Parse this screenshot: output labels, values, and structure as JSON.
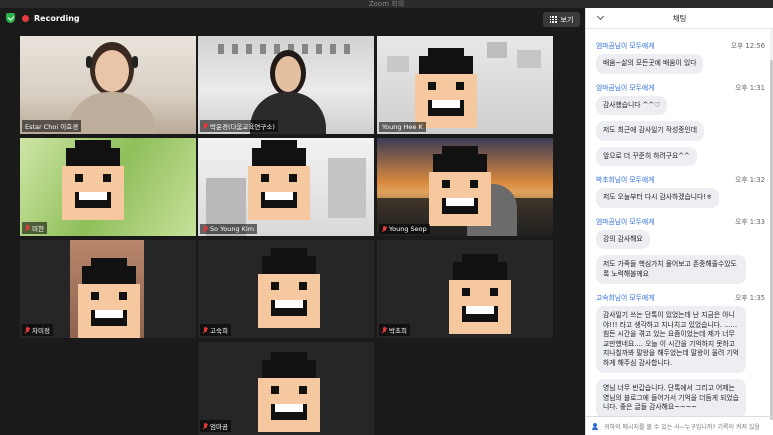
{
  "window": {
    "title": "Zoom 회의"
  },
  "recording": {
    "label": "Recording"
  },
  "view_button": {
    "label": "보기",
    "icon": "grid-icon"
  },
  "participants": [
    {
      "name": "Estar Choi 이효경",
      "muted": false,
      "active": true,
      "type": "photo"
    },
    {
      "name": "박윤경(다움교육연구소)",
      "muted": true,
      "active": false,
      "type": "photo"
    },
    {
      "name": "Young Hee K",
      "muted": false,
      "active": false,
      "type": "avatar"
    },
    {
      "name": "미현",
      "muted": true,
      "active": false,
      "type": "avatar"
    },
    {
      "name": "So Young Kim",
      "muted": true,
      "active": false,
      "type": "avatar"
    },
    {
      "name": "Young Seop",
      "muted": true,
      "active": false,
      "type": "avatar"
    },
    {
      "name": "차미정",
      "muted": true,
      "active": false,
      "type": "avatar"
    },
    {
      "name": "고숙희",
      "muted": true,
      "active": false,
      "type": "avatar"
    },
    {
      "name": "박초희",
      "muted": true,
      "active": false,
      "type": "avatar"
    },
    {
      "name": "엄마곰",
      "muted": true,
      "active": false,
      "type": "avatar"
    }
  ],
  "chat": {
    "title": "채팅",
    "messages": [
      {
        "from": "엄마곰님이 모두에게",
        "time": "오후 12:56",
        "text": "배움~삶의 모든곳에 배움이 있다"
      },
      {
        "from": "엄마곰님이 모두에게",
        "time": "오후 1:31",
        "text": "감사했습니다 ^^♡"
      },
      {
        "from": "",
        "time": "",
        "text": "저도 최근에 감사일기 작성중인데"
      },
      {
        "from": "",
        "time": "",
        "text": "앞으로 더 꾸준히 하려구요^^"
      },
      {
        "from": "박초희님이 모두에게",
        "time": "오후 1:32",
        "text": "저도 오늘부터 다시 감사하겠습니다!ㅎ"
      },
      {
        "from": "엄마곰님이 모두에게",
        "time": "오후 1:33",
        "text": "강의 감사해요"
      },
      {
        "from": "",
        "time": "",
        "text": "저도 가족들 핵심가치 물어보고 존중해줄수있도록 노력해볼께요"
      },
      {
        "from": "고숙희님이 모두에게",
        "time": "오후 1:35",
        "text": "감사일기 쓰는 단톡이 있었는데 난 지금은 아니야!!! 라고 생각하고 지나치고 있었습니다. ...... 힘든 시간을 겪고 있는 요즘이었는데 제가 너무 교만했네요.... 오늘 이 시간을 기억하지 못하고 지나칠까봐 말왕을 해두었는데 말왕이 울려 기억하게 해주심 감사합니다."
      },
      {
        "from": "",
        "time": "",
        "text": "영님 너무 반갑습니다. 단톡에서 그리고 어제는 영님의 블로그에 들어가서 기억을 더듬게 되었습니다. 좋은 글들 감사해요~~~~"
      }
    ],
    "input_placeholder": "귀하의 메시지를 볼 수 있는 사~누구입니까? 기록이 켜져 있음"
  }
}
